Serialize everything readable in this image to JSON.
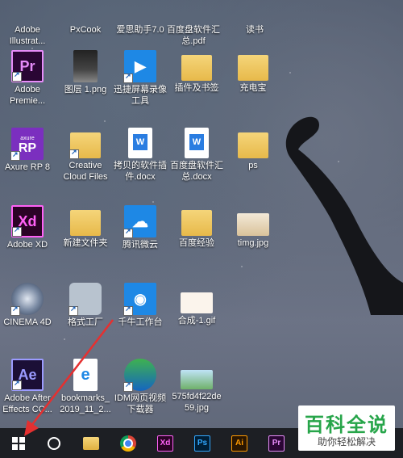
{
  "desktop": {
    "icons": [
      {
        "label": "Adobe\nIllustrat..."
      },
      {
        "label": "PxCook"
      },
      {
        "label": "爱思助手7.0"
      },
      {
        "label": "百度盘软件汇\n总.pdf"
      },
      {
        "label": "读书"
      },
      {
        "label": "Adobe\nPremie...",
        "glyph": "Pr"
      },
      {
        "label": "图层 1.png"
      },
      {
        "label": "迅捷屏幕录像\n工具"
      },
      {
        "label": "插件及书签"
      },
      {
        "label": "充电宝"
      },
      {
        "label": "Axure RP 8",
        "glyph": "RP",
        "glyph_small": "axure"
      },
      {
        "label": "Creative\nCloud Files"
      },
      {
        "label": "拷贝的软件插\n件.docx",
        "glyph": "W"
      },
      {
        "label": "百度盘软件汇\n总.docx",
        "glyph": "W"
      },
      {
        "label": "ps"
      },
      {
        "label": "Adobe XD",
        "glyph": "Xd"
      },
      {
        "label": "新建文件夹"
      },
      {
        "label": "腾讯微云"
      },
      {
        "label": "百度经验"
      },
      {
        "label": "timg.jpg"
      },
      {
        "label": "CINEMA 4D"
      },
      {
        "label": "格式工厂"
      },
      {
        "label": "千牛工作台"
      },
      {
        "label": "合成-1.gif"
      },
      {
        "label": "Adobe After\nEffects CC...",
        "glyph": "Ae"
      },
      {
        "label": "bookmarks_\n2019_11_2..."
      },
      {
        "label": "IDM网页视频\n下载器"
      },
      {
        "label": "575fd4f22de\n59.jpg"
      }
    ]
  },
  "taskbar": {
    "items": [
      {
        "name": "file-explorer"
      },
      {
        "name": "chrome"
      },
      {
        "name": "adobe-xd",
        "glyph": "Xd"
      },
      {
        "name": "photoshop",
        "glyph": "Ps"
      },
      {
        "name": "illustrator",
        "glyph": "Ai"
      },
      {
        "name": "premiere",
        "glyph": "Pr"
      }
    ]
  },
  "watermark": {
    "title": "百科全说",
    "subtitle": "助你轻松解决"
  },
  "colors": {
    "arrow": "#e53030",
    "taskbar_bg": "#1d1f24",
    "watermark_green": "#27a54a"
  }
}
